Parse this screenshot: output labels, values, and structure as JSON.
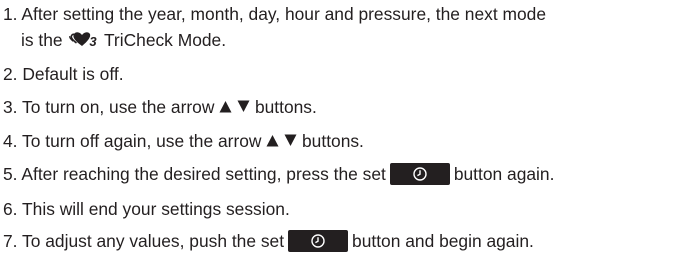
{
  "items": [
    {
      "num": "1.",
      "text_a": "After setting the year, month, day, hour and pressure, the next mode",
      "text_b_prefix": "is the",
      "icon": "tricheck-hearts-icon",
      "icon_subscript": "3",
      "text_b_suffix": "TriCheck Mode."
    },
    {
      "num": "2.",
      "text": "Default is off."
    },
    {
      "num": "3.",
      "text_prefix": "To turn on, use the arrow",
      "icons": [
        "up-triangle-icon",
        "down-triangle-icon"
      ],
      "text_suffix": "buttons."
    },
    {
      "num": "4.",
      "text_prefix": "To turn off again, use the arrow",
      "icons": [
        "up-triangle-icon",
        "down-triangle-icon"
      ],
      "text_suffix": "buttons."
    },
    {
      "num": "5.",
      "text_prefix": "After reaching the desired setting, press the set",
      "icon": "clock-icon",
      "text_suffix": "button again."
    },
    {
      "num": "6.",
      "text": "This will end your settings session."
    },
    {
      "num": "7.",
      "text_prefix": "To adjust any values, push the set",
      "icon": "clock-icon",
      "text_suffix": "button and begin again."
    }
  ],
  "colors": {
    "text": "#231f20",
    "button": "#231f20",
    "background": "#ffffff"
  }
}
